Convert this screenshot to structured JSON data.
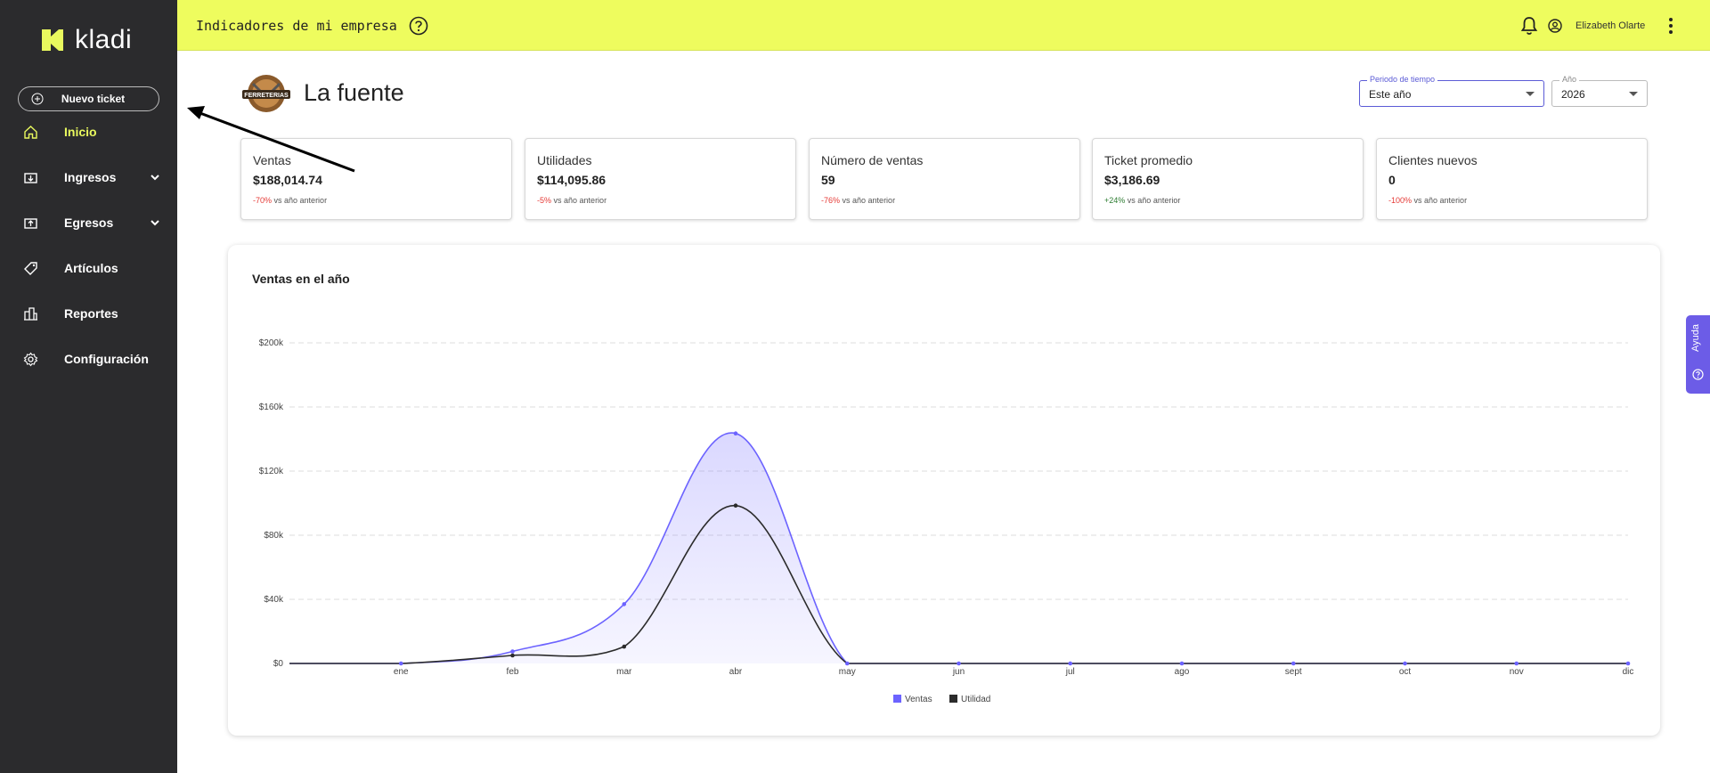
{
  "sidebar": {
    "logo_text": "kladi",
    "new_ticket": "Nuevo ticket",
    "items": [
      {
        "label": "Inicio",
        "icon": "home-icon",
        "active": true
      },
      {
        "label": "Ingresos",
        "icon": "income-icon",
        "expandable": true
      },
      {
        "label": "Egresos",
        "icon": "expense-icon",
        "expandable": true
      },
      {
        "label": "Artículos",
        "icon": "tag-icon"
      },
      {
        "label": "Reportes",
        "icon": "buildings-icon"
      },
      {
        "label": "Configuración",
        "icon": "gear-icon"
      }
    ]
  },
  "topbar": {
    "title": "Indicadores de mi empresa",
    "user_name": "Elizabeth Olarte"
  },
  "company": {
    "name": "La fuente",
    "logo_text": "FERRETERIAS"
  },
  "filters": {
    "period": {
      "label": "Periodo de tiempo",
      "value": "Este año"
    },
    "year": {
      "label": "Año",
      "value": "2026"
    }
  },
  "kpis": [
    {
      "title": "Ventas",
      "value": "$188,014.74",
      "delta": "-70%",
      "delta_sign": "neg",
      "suffix": "vs año anterior"
    },
    {
      "title": "Utilidades",
      "value": "$114,095.86",
      "delta": "-5%",
      "delta_sign": "neg",
      "suffix": "vs año anterior"
    },
    {
      "title": "Número de ventas",
      "value": "59",
      "delta": "-76%",
      "delta_sign": "neg",
      "suffix": "vs año anterior"
    },
    {
      "title": "Ticket promedio",
      "value": "$3,186.69",
      "delta": "+24%",
      "delta_sign": "pos",
      "suffix": "vs año anterior"
    },
    {
      "title": "Clientes nuevos",
      "value": "0",
      "delta": "-100%",
      "delta_sign": "neg",
      "suffix": "vs año anterior"
    }
  ],
  "help_tab": "Ayuda",
  "colors": {
    "accent": "#eefc5e",
    "sidebar": "#2b2b2d",
    "ventas": "#6c63ff",
    "utilidad": "#2b2b2b",
    "negative": "#e53935",
    "positive": "#2e7d32"
  },
  "chart_data": {
    "type": "area",
    "title": "Ventas en el año",
    "categories": [
      "ene",
      "feb",
      "mar",
      "abr",
      "may",
      "jun",
      "jul",
      "ago",
      "sept",
      "oct",
      "nov",
      "dic"
    ],
    "y_ticks": [
      "$0",
      "$40k",
      "$80k",
      "$120k",
      "$160k",
      "$200k"
    ],
    "ylim": [
      0,
      200000
    ],
    "series": [
      {
        "name": "Ventas",
        "values": [
          0,
          7500,
          37000,
          143500,
          0,
          0,
          0,
          0,
          0,
          0,
          0,
          0
        ]
      },
      {
        "name": "Utilidad",
        "values": [
          0,
          5000,
          10500,
          98500,
          0,
          0,
          0,
          0,
          0,
          0,
          0,
          0
        ]
      }
    ],
    "legend": "bottom",
    "grid": true
  }
}
